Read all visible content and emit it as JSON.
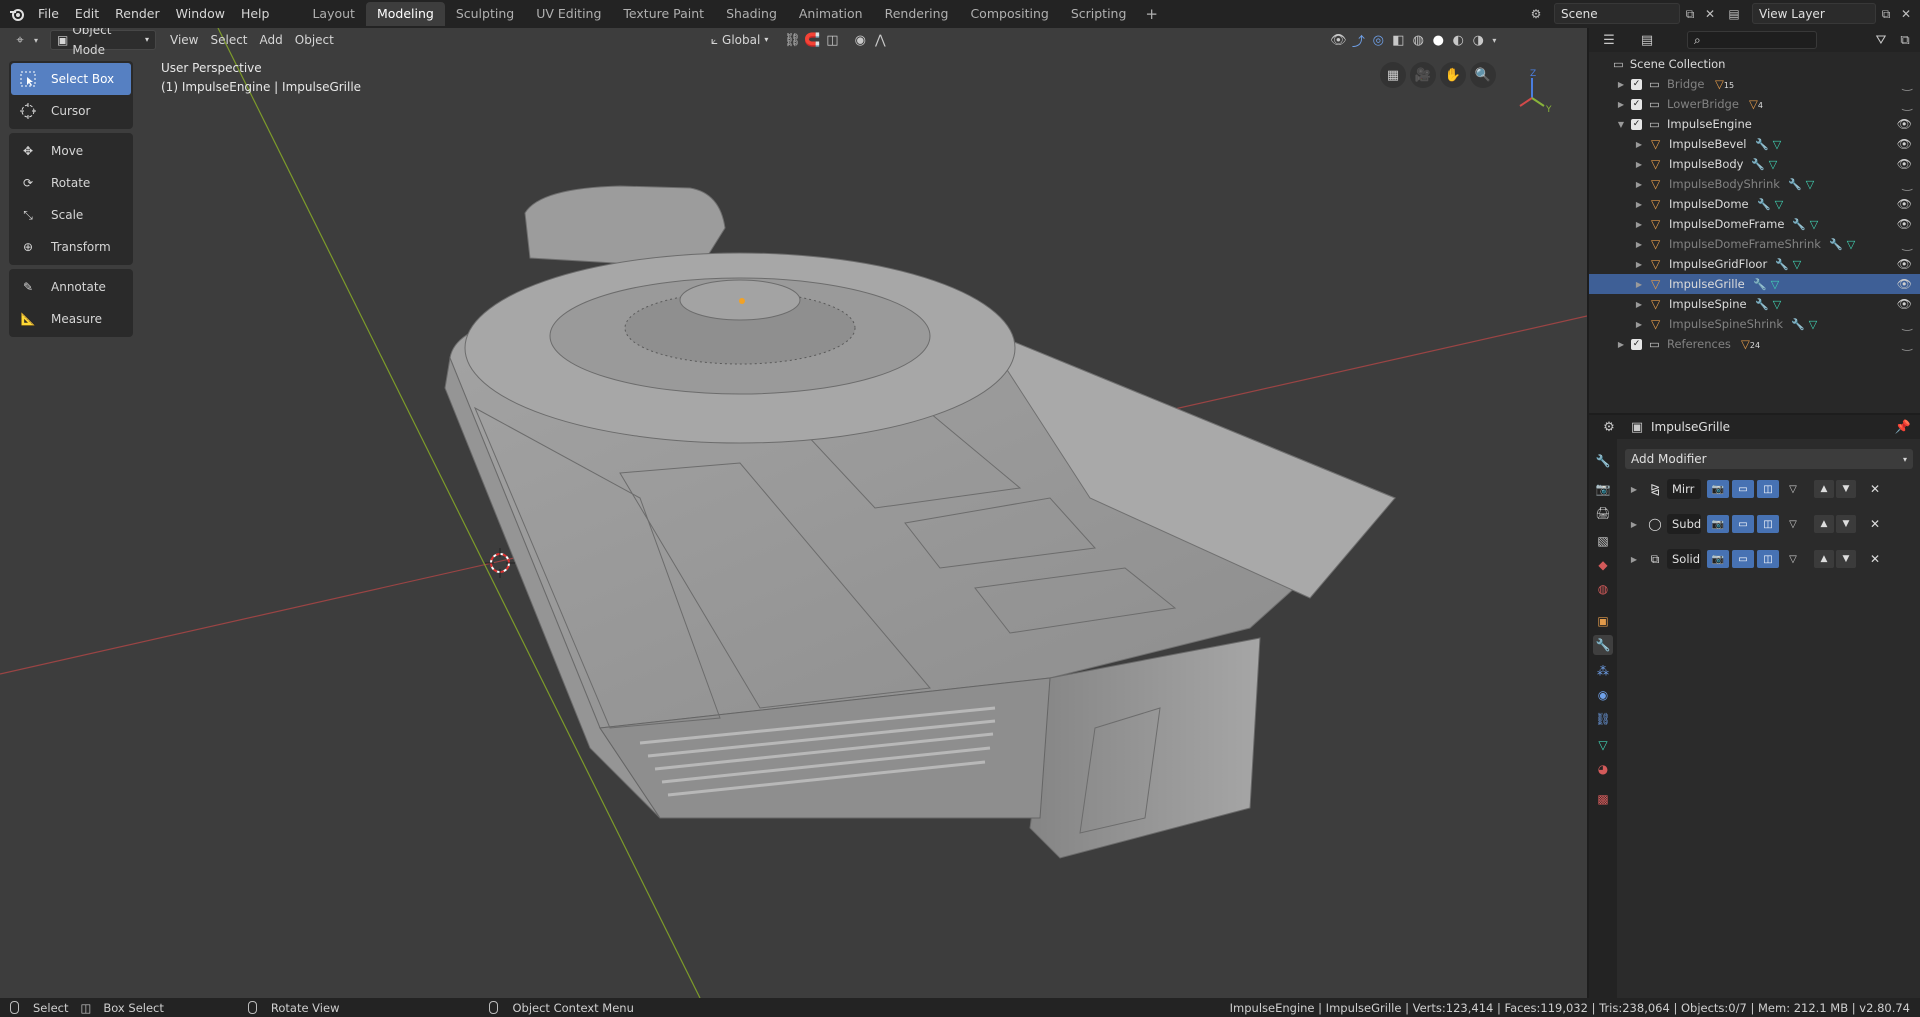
{
  "menu": [
    "File",
    "Edit",
    "Render",
    "Window",
    "Help"
  ],
  "workspaces": [
    "Layout",
    "Modeling",
    "Sculpting",
    "UV Editing",
    "Texture Paint",
    "Shading",
    "Animation",
    "Rendering",
    "Compositing",
    "Scripting"
  ],
  "active_workspace": "Modeling",
  "scene_name": "Scene",
  "view_layer": "View Layer",
  "viewport_header": {
    "mode": "Object Mode",
    "menus": [
      "View",
      "Select",
      "Add",
      "Object"
    ],
    "orientation": "Global"
  },
  "tools": [
    {
      "group": 1,
      "label": "Select Box",
      "icon": "select-box-icon",
      "active": true
    },
    {
      "group": 1,
      "label": "Cursor",
      "icon": "cursor-icon"
    },
    {
      "group": 2,
      "label": "Move",
      "icon": "move-icon"
    },
    {
      "group": 2,
      "label": "Rotate",
      "icon": "rotate-icon"
    },
    {
      "group": 2,
      "label": "Scale",
      "icon": "scale-icon"
    },
    {
      "group": 2,
      "label": "Transform",
      "icon": "transform-icon"
    },
    {
      "group": 3,
      "label": "Annotate",
      "icon": "annotate-icon"
    },
    {
      "group": 3,
      "label": "Measure",
      "icon": "measure-icon"
    }
  ],
  "viewport_info": {
    "perspective": "User Perspective",
    "object": "(1) ImpulseEngine | ImpulseGrille"
  },
  "outliner": {
    "root": "Scene Collection",
    "rows": [
      {
        "label": "Bridge",
        "level": 1,
        "type": "collection",
        "dim": true,
        "badge": "15"
      },
      {
        "label": "LowerBridge",
        "level": 1,
        "type": "collection",
        "dim": true,
        "badge": "4"
      },
      {
        "label": "ImpulseEngine",
        "level": 1,
        "type": "collection",
        "expanded": true,
        "eye": true
      },
      {
        "label": "ImpulseBevel",
        "level": 2,
        "type": "object",
        "eye": true
      },
      {
        "label": "ImpulseBody",
        "level": 2,
        "type": "object",
        "eye": true
      },
      {
        "label": "ImpulseBodyShrink",
        "level": 2,
        "type": "object",
        "dim": true
      },
      {
        "label": "ImpulseDome",
        "level": 2,
        "type": "object",
        "eye": true
      },
      {
        "label": "ImpulseDomeFrame",
        "level": 2,
        "type": "object",
        "eye": true
      },
      {
        "label": "ImpulseDomeFrameShrink",
        "level": 2,
        "type": "object",
        "dim": true
      },
      {
        "label": "ImpulseGridFloor",
        "level": 2,
        "type": "object",
        "eye": true
      },
      {
        "label": "ImpulseGrille",
        "level": 2,
        "type": "object",
        "eye": true,
        "selected": true
      },
      {
        "label": "ImpulseSpine",
        "level": 2,
        "type": "object",
        "eye": true
      },
      {
        "label": "ImpulseSpineShrink",
        "level": 2,
        "type": "object",
        "dim": true
      },
      {
        "label": "References",
        "level": 1,
        "type": "collection",
        "dim": true,
        "badge": "24"
      }
    ]
  },
  "properties": {
    "object_name": "ImpulseGrille",
    "add_modifier": "Add Modifier",
    "modifiers": [
      "Mirr",
      "Subd",
      "Solid"
    ]
  },
  "status": {
    "select": "Select",
    "box_select": "Box Select",
    "rotate_view": "Rotate View",
    "context_menu": "Object Context Menu",
    "stats": "ImpulseEngine | ImpulseGrille | Verts:123,414 | Faces:119,032 | Tris:238,064 | Objects:0/7 | Mem: 212.1 MB | v2.80.74"
  },
  "colors": {
    "accent": "#5680c2",
    "selected_row": "#3e5f96",
    "x_axis": "#b44a4a",
    "y_axis": "#8db32a"
  }
}
